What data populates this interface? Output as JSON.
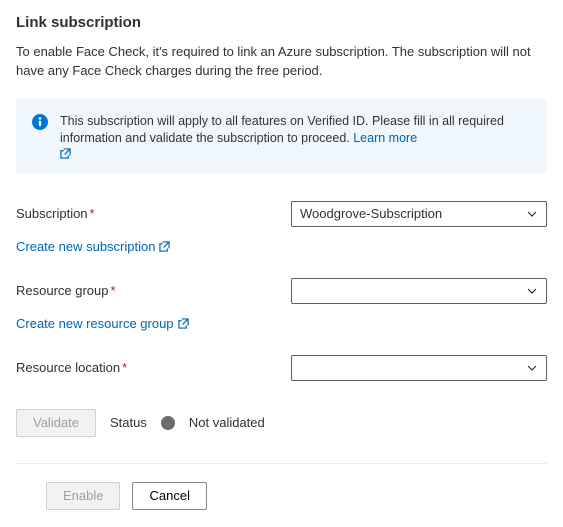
{
  "title": "Link subscription",
  "intro": "To enable Face Check, it's required to link an Azure subscription. The subscription will not have any Face Check charges during the free period.",
  "info": {
    "text": "This subscription will apply to all features on Verified ID. Please fill in all required information and validate the subscription to proceed. ",
    "learn_more": "Learn more"
  },
  "fields": {
    "subscription": {
      "label": "Subscription",
      "value": "Woodgrove-Subscription",
      "create_link": "Create new subscription"
    },
    "resource_group": {
      "label": "Resource group",
      "value": "",
      "create_link": "Create new resource group"
    },
    "resource_location": {
      "label": "Resource location",
      "value": ""
    }
  },
  "validate": {
    "button": "Validate",
    "status_label": "Status",
    "status_text": "Not validated"
  },
  "footer": {
    "enable": "Enable",
    "cancel": "Cancel"
  }
}
